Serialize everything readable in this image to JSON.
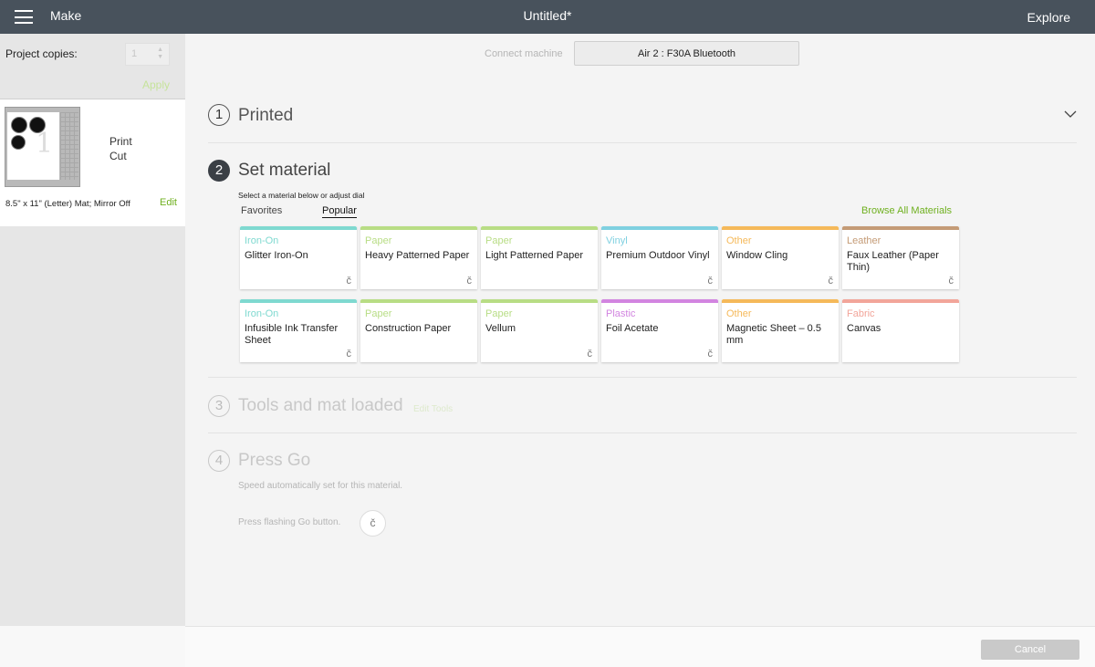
{
  "topbar": {
    "make": "Make",
    "title": "Untitled*",
    "explore": "Explore"
  },
  "sidebar": {
    "copies_label": "Project copies:",
    "copies_value": "1",
    "apply": "Apply",
    "mat": {
      "print": "Print",
      "cut": "Cut",
      "info": "8.5\" x 11\" (Letter) Mat; Mirror Off",
      "edit": "Edit"
    }
  },
  "connect": {
    "label": "Connect machine",
    "machine": "Air 2 : F30A Bluetooth"
  },
  "steps": {
    "s1": {
      "num": "1",
      "title": "Printed"
    },
    "s2": {
      "num": "2",
      "title": "Set material"
    },
    "s3": {
      "num": "3",
      "title": "Tools and mat loaded",
      "edit_tools": "Edit Tools"
    },
    "s4": {
      "num": "4",
      "title": "Press Go",
      "speed": "Speed automatically set for this material.",
      "go": "Press flashing Go button."
    }
  },
  "material": {
    "hint": "Select a material below or adjust dial",
    "tabs": {
      "favorites": "Favorites",
      "popular": "Popular"
    },
    "browse": "Browse All Materials",
    "tiles": [
      {
        "cat": "Iron-On",
        "name": "Glitter Iron-On",
        "color": "#7fd9d0",
        "logo": true
      },
      {
        "cat": "Paper",
        "name": "Heavy Patterned Paper",
        "color": "#b8dd85",
        "logo": true
      },
      {
        "cat": "Paper",
        "name": "Light Patterned Paper",
        "color": "#b8dd85",
        "logo": false
      },
      {
        "cat": "Vinyl",
        "name": "Premium Outdoor Vinyl",
        "color": "#7fd0e0",
        "logo": true
      },
      {
        "cat": "Other",
        "name": "Window Cling",
        "color": "#f5b95a",
        "logo": true
      },
      {
        "cat": "Leather",
        "name": "Faux Leather (Paper Thin)",
        "color": "#c49b76",
        "logo": true
      },
      {
        "cat": "Iron-On",
        "name": "Infusible Ink Transfer Sheet",
        "color": "#7fd9d0",
        "logo": true
      },
      {
        "cat": "Paper",
        "name": "Construction Paper",
        "color": "#b8dd85",
        "logo": false
      },
      {
        "cat": "Paper",
        "name": "Vellum",
        "color": "#b8dd85",
        "logo": true
      },
      {
        "cat": "Plastic",
        "name": "Foil Acetate",
        "color": "#d285e0",
        "logo": true
      },
      {
        "cat": "Other",
        "name": "Magnetic Sheet – 0.5 mm",
        "color": "#f5b95a",
        "logo": false
      },
      {
        "cat": "Fabric",
        "name": "Canvas",
        "color": "#f2a59a",
        "logo": false
      }
    ]
  },
  "cancel": "Cancel",
  "logo_glyph": "č"
}
